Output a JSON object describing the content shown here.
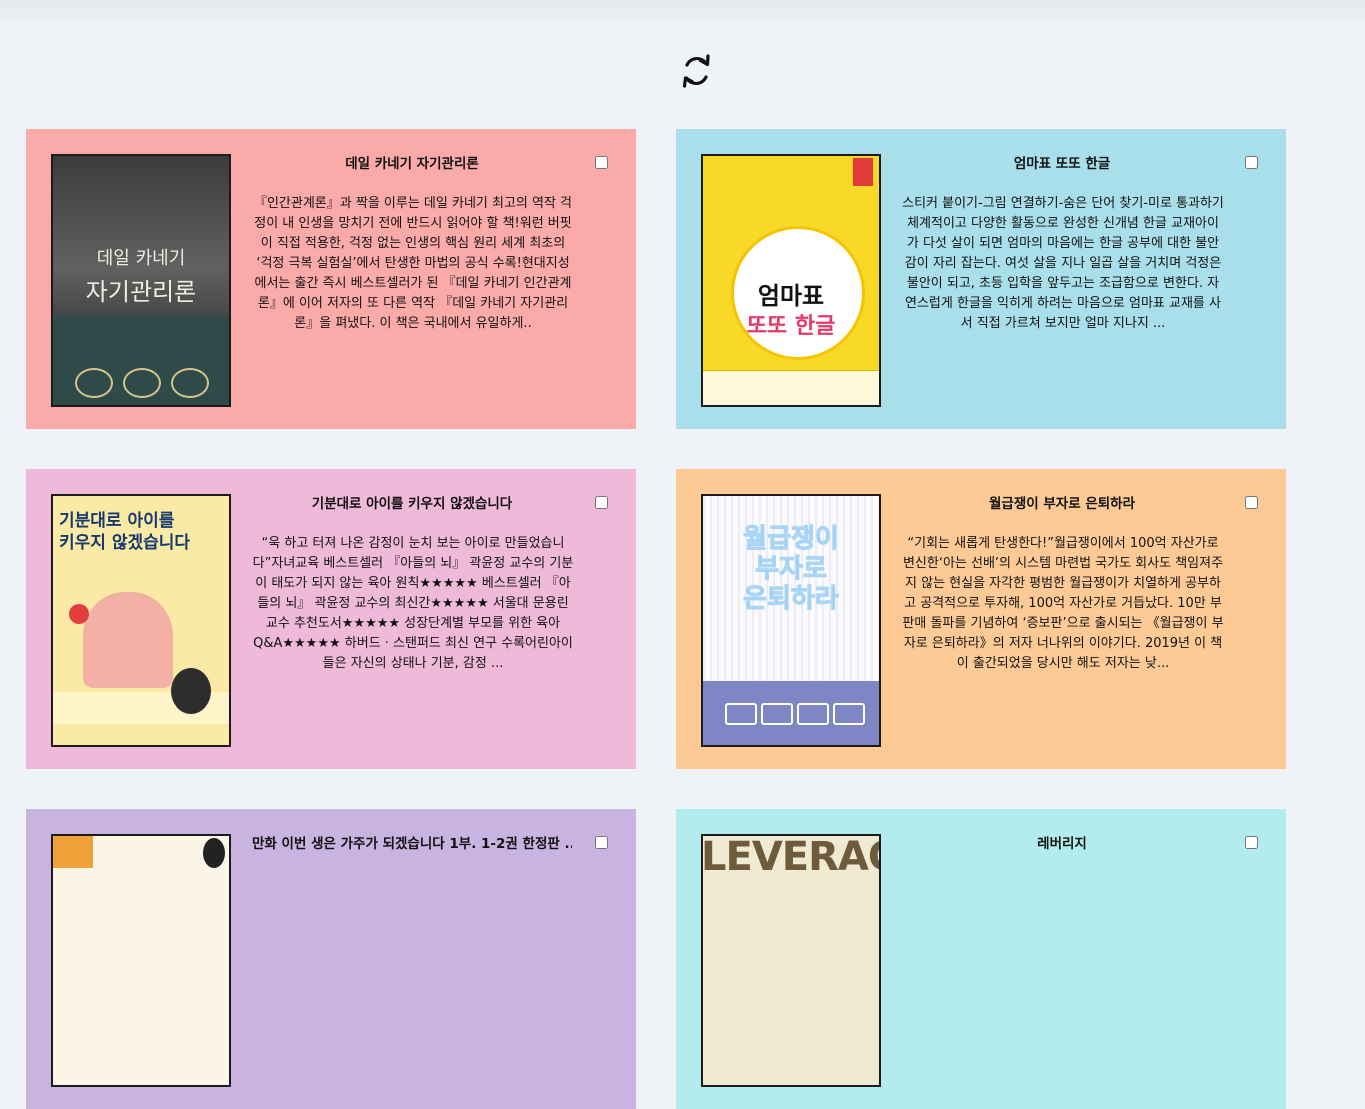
{
  "refresh": {
    "icon": "refresh-icon"
  },
  "books": [
    {
      "title": "데일 카네기 자기관리론",
      "description": "『인간관계론』과 짝을 이루는 데일 카네기 최고의 역작 걱정이 내 인생을 망치기 전에 반드시 읽어야 할 책!워런 버핏이 직접 적용한, 걱정 없는 인생의 핵심 원리 세계 최초의 ‘걱정 극복 실험실’에서 탄생한 마법의 공식 수록!현대지성에서는 출간 즉시 베스트셀러가 된 『데일 카네기 인간관계론』에 이어 저자의 또 다른 역작 『데일 카네기 자기관리론』을 펴냈다. 이 책은 국내에서 유일하게..",
      "cover_line1": "데일 카네기",
      "cover_line2": "자기관리론",
      "background": "#fbaaaa"
    },
    {
      "title": "엄마표 또또 한글",
      "description": "스티커 붙이기-그림 연결하기-숨은 단어 찾기-미로 통과하기 체계적이고 다양한 활동으로 완성한 신개념 한글 교재아이가 다섯 살이 되면 엄마의 마음에는 한글 공부에 대한 불안감이 자리 잡는다. 여섯 살을 지나 일곱 살을 거치며 걱정은 불안이 되고, 초등 입학을 앞두고는 조급함으로 변한다. 자연스럽게 한글을 익히게 하려는 마음으로 엄마표 교재를 사서 직접 가르쳐 보지만 얼마 지나지 ...",
      "cover_line1": "엄마표",
      "cover_line2": "또또 한글",
      "background": "#a8dfea"
    },
    {
      "title": "기분대로 아이를 키우지 않겠습니다",
      "description": "“욱 하고 터져 나온 감정이 눈치 보는 아이로 만들었습니다”자녀교육 베스트셀러 『아들의 뇌』 곽윤정 교수의 기분이 태도가 되지 않는 육아 원칙★★★★★ 베스트셀러 『아들의 뇌』 곽윤정 교수의 최신간★★★★★ 서울대 문용린 교수 추천도서★★★★★ 성장단계별 부모를 위한 육아 Q&A★★★★★ 하버드 · 스탠퍼드 최신 연구 수록어린아이들은 자신의 상태나 기분, 감정 ...",
      "cover_line1": "기분대로 아이를",
      "cover_line2": "키우지 않겠습니다",
      "background": "#efb9d9"
    },
    {
      "title": "월급쟁이 부자로 은퇴하라",
      "description": "“기회는 새롭게 탄생한다!”월급쟁이에서 100억 자산가로 변신한‘아는 선배’의 시스템 마련법 국가도 회사도 책임져주지 않는 현실을 자각한 평범한 월급쟁이가 치열하게 공부하고 공격적으로 투자해, 100억 자산가로 거듭났다. 10만 부 판매 돌파를 기념하여 ‘증보판’으로 출시되는 《월급쟁이 부자로 은퇴하라》의 저자 너나위의 이야기다. 2019년 이 책이 출간되었을 당시만 해도 저자는 낮...",
      "cover_line1": "월급쟁이",
      "cover_line2": "부자로",
      "cover_line3": "은퇴하라",
      "background": "#fdca96"
    },
    {
      "title": "만화 이번 생은 가주가 되겠습니다 1부. 1-2권 한정판 ...",
      "description": "",
      "background": "#c9b3e1"
    },
    {
      "title": "레버리지",
      "description": "",
      "cover_line1": "LEVERAGE",
      "background": "#b3ecee"
    }
  ]
}
